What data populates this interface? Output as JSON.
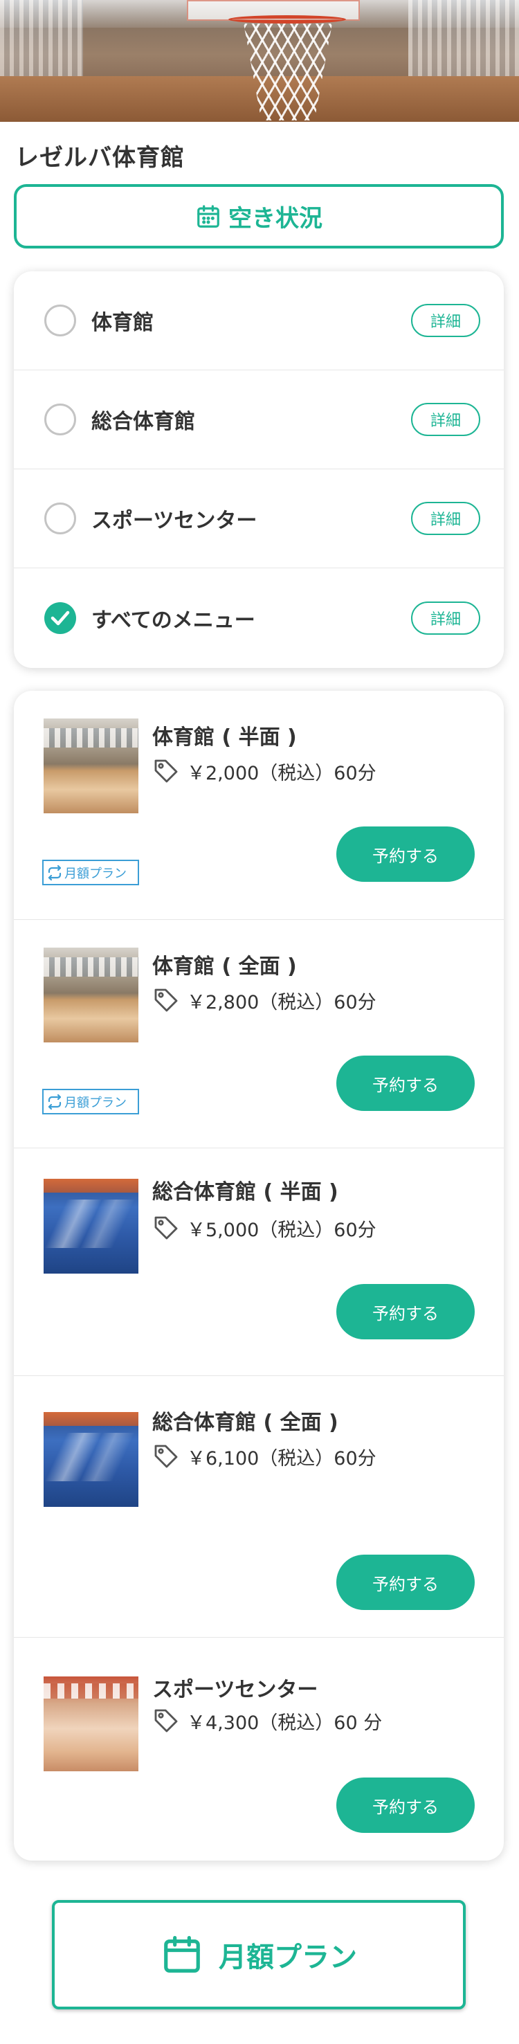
{
  "venue": {
    "name": "レゼルバ体育館"
  },
  "availability": {
    "label": "空き状況",
    "icon": "calendar-icon",
    "color": "#1db594"
  },
  "filters": [
    {
      "label": "体育館",
      "checked": false,
      "detail_label": "詳細"
    },
    {
      "label": "総合体育館",
      "checked": false,
      "detail_label": "詳細"
    },
    {
      "label": "スポーツセンター",
      "checked": false,
      "detail_label": "詳細"
    },
    {
      "label": "すべてのメニュー",
      "checked": true,
      "detail_label": "詳細"
    }
  ],
  "menus": [
    {
      "title": "体育館 ( 半面 )",
      "price": "￥2,000（税込）60分",
      "reserve_label": "予約する",
      "badge": "月額プラン",
      "thumb": "wood-gym-photo"
    },
    {
      "title": "体育館 ( 全面 )",
      "price": "￥2,800（税込）60分",
      "reserve_label": "予約する",
      "badge": "月額プラン",
      "thumb": "wood-gym-photo"
    },
    {
      "title": "総合体育館 ( 半面 )",
      "price": "￥5,000（税込）60分",
      "reserve_label": "予約する",
      "badge": null,
      "thumb": "blue-court-photo"
    },
    {
      "title": "総合体育館 ( 全面 )",
      "price": "￥6,100（税込）60分",
      "reserve_label": "予約する",
      "badge": null,
      "thumb": "blue-court-photo"
    },
    {
      "title": "スポーツセンター",
      "price": "￥4,300（税込）60 分",
      "reserve_label": "予約する",
      "badge": null,
      "thumb": "orange-hall-photo"
    }
  ],
  "monthly_plan": {
    "label": "月額プラン",
    "icon": "calendar-icon"
  },
  "colors": {
    "accent": "#1db594",
    "badge": "#3b9ed6",
    "text": "#333333"
  }
}
